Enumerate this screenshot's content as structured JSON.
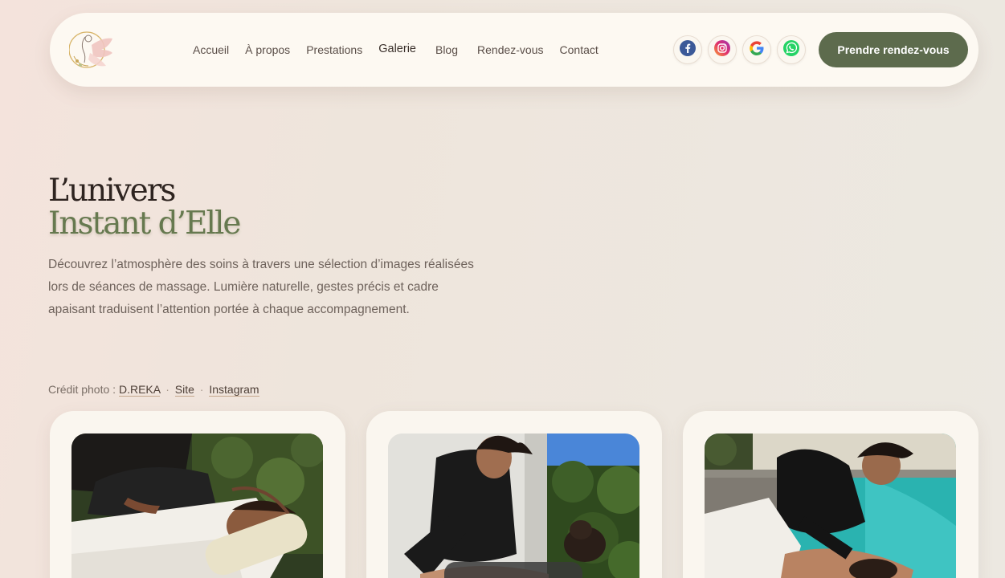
{
  "header": {
    "nav": [
      {
        "label": "Accueil"
      },
      {
        "label": "À propos"
      },
      {
        "label": "Prestations"
      },
      {
        "label": "Galerie",
        "active": true
      },
      {
        "label": "Blog"
      },
      {
        "label": "Rendez-vous"
      },
      {
        "label": "Contact"
      }
    ],
    "socials": [
      "facebook-icon",
      "instagram-icon",
      "google-icon",
      "whatsapp-icon"
    ],
    "cta_label": "Prendre rendez-vous"
  },
  "hero": {
    "title_line1": "L’univers",
    "title_line2": "Instant d’Elle",
    "description": "Découvrez l’atmosphère des soins à travers une sélection d’images réalisées lors de séances de massage. Lumière naturelle, gestes précis et cadre apaisant traduisent l’attention portée à chaque accompagnement."
  },
  "credit": {
    "prefix": "Crédit photo :",
    "photographer": "D.REKA",
    "separator": "·",
    "site": "Site",
    "instagram": "Instagram"
  },
  "gallery": {
    "photos": [
      "massage-photo-1",
      "massage-photo-2",
      "massage-photo-3"
    ]
  },
  "colors": {
    "accent": "#5d6b4d",
    "title_green": "#66794f",
    "header_bg": "#fdf9f2"
  }
}
